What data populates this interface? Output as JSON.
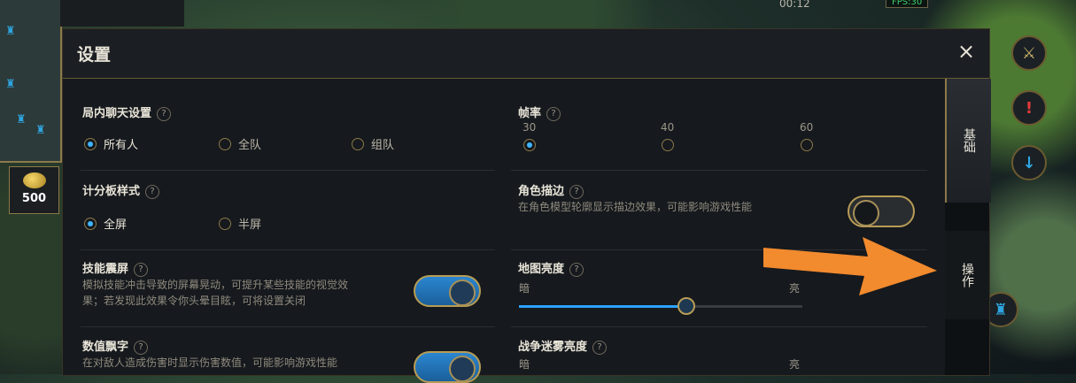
{
  "hud": {
    "timer": "00:12",
    "fps": "FPS:30",
    "gold": "500"
  },
  "panel": {
    "title": "设置",
    "close_icon": "×"
  },
  "tabs": [
    {
      "label": "基础",
      "active": true
    },
    {
      "label": "操作",
      "active": false
    }
  ],
  "settings": {
    "chat": {
      "title": "局内聊天设置",
      "options": [
        "所有人",
        "全队",
        "组队"
      ],
      "selected": "所有人"
    },
    "framerate": {
      "title": "帧率",
      "options": [
        "30",
        "40",
        "60"
      ],
      "selected": "30"
    },
    "scoreboard": {
      "title": "计分板样式",
      "options": [
        "全屏",
        "半屏"
      ],
      "selected": "全屏"
    },
    "outline": {
      "title": "角色描边",
      "desc": "在角色模型轮廓显示描边效果，可能影响游戏性能",
      "enabled": false
    },
    "shake": {
      "title": "技能震屏",
      "desc_line1": "模拟技能冲击导致的屏幕晃动，可提升某些技能的视觉效",
      "desc_line2": "果；若发现此效果令你头晕目眩，可将设置关闭",
      "enabled": true
    },
    "map_brightness": {
      "title": "地图亮度",
      "min_label": "暗",
      "max_label": "亮",
      "value": 0.59
    },
    "damage_numbers": {
      "title": "数值飘字",
      "desc": "在对敌人造成伤害时显示伤害数值，可能影响游戏性能",
      "enabled": true
    },
    "fog_brightness": {
      "title": "战争迷雾亮度",
      "min_label": "暗",
      "max_label": "亮"
    }
  },
  "help_mark": "?",
  "colors": {
    "accent_blue": "#2ba3ff",
    "gold_border": "#b79c55",
    "arrow": "#f28a2e"
  }
}
